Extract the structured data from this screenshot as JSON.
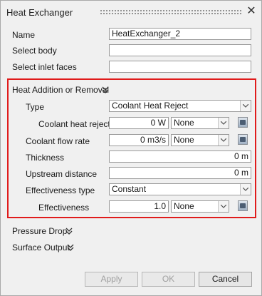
{
  "window": {
    "title": "Heat Exchanger"
  },
  "basic": {
    "name_label": "Name",
    "name_value": "HeatExchanger_2",
    "body_label": "Select body",
    "body_value": "",
    "inlet_label": "Select inlet faces",
    "inlet_value": ""
  },
  "heat": {
    "section_title": "Heat Addition or Removal",
    "type_label": "Type",
    "type_value": "Coolant Heat Reject",
    "reject_label": "Coolant heat reject",
    "reject_value": "0 W",
    "reject_unit": "None",
    "flow_label": "Coolant flow rate",
    "flow_value": "0 m3/s",
    "flow_unit": "None",
    "thickness_label": "Thickness",
    "thickness_value": "0 m",
    "upstream_label": "Upstream distance",
    "upstream_value": "0 m",
    "eff_type_label": "Effectiveness type",
    "eff_type_value": "Constant",
    "eff_label": "Effectiveness",
    "eff_value": "1.0",
    "eff_unit": "None"
  },
  "sections": {
    "pressure_drop": "Pressure Drop",
    "surface_output": "Surface Output"
  },
  "buttons": {
    "apply": "Apply",
    "ok": "OK",
    "cancel": "Cancel"
  },
  "colors": {
    "highlight_border": "#e01b1b"
  }
}
